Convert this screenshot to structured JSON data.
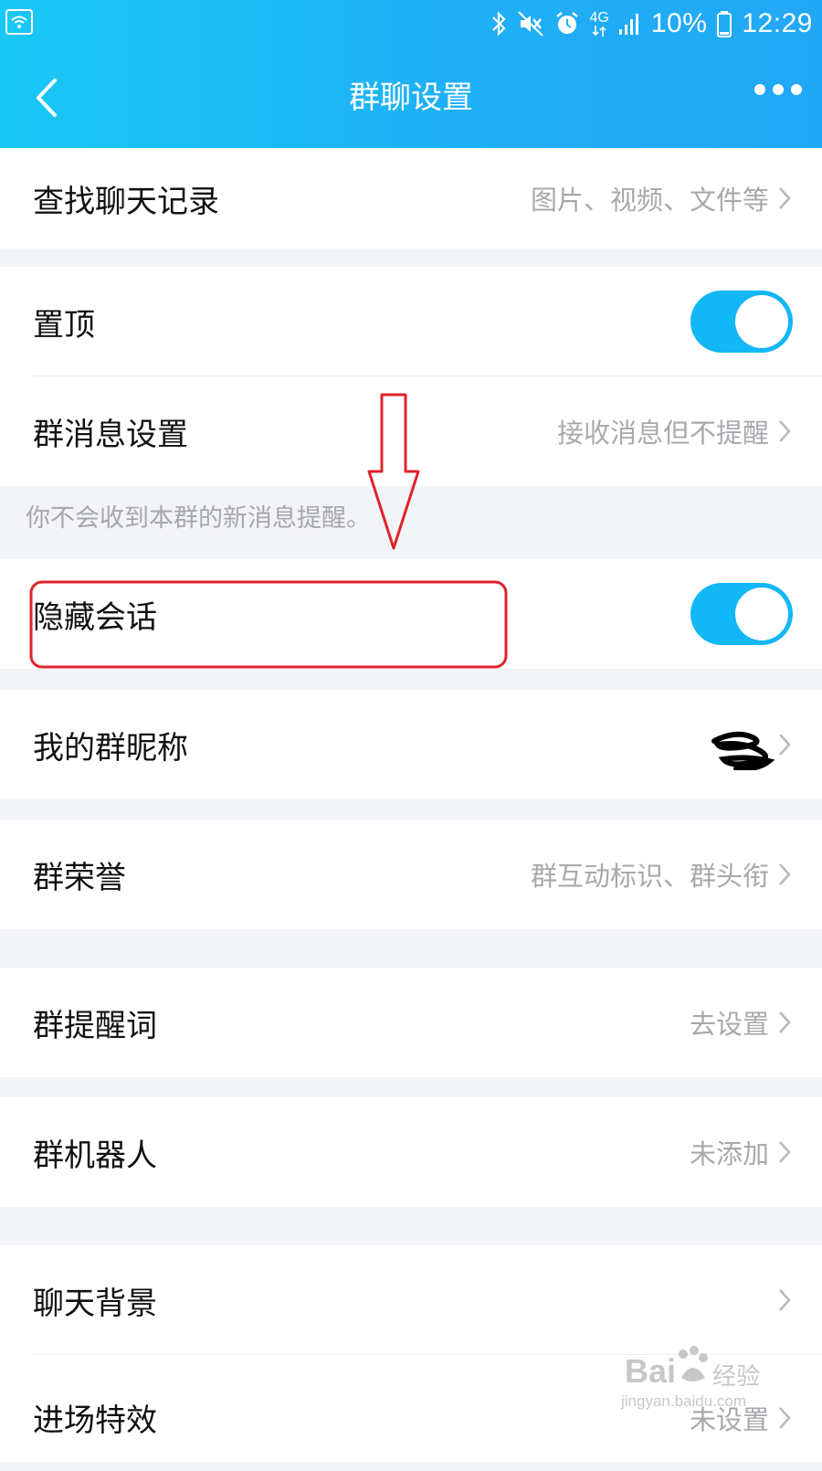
{
  "status_bar": {
    "battery": "10%",
    "time": "12:29",
    "network": "4G",
    "icons": [
      "wifi-icon",
      "bluetooth-icon",
      "mute-icon",
      "alarm-icon",
      "network-4g-icon",
      "signal-icon",
      "battery-icon"
    ]
  },
  "header": {
    "title": "群聊设置",
    "back_icon": "chevron-left-icon",
    "more_icon": "more-dots-icon"
  },
  "rows": {
    "search_history": {
      "label": "查找聊天记录",
      "value": "图片、视频、文件等"
    },
    "pin_top": {
      "label": "置顶",
      "toggle": true
    },
    "message_settings": {
      "label": "群消息设置",
      "value": "接收消息但不提醒"
    },
    "hint": "你不会收到本群的新消息提醒。",
    "hide_chat": {
      "label": "隐藏会话",
      "toggle": true
    },
    "nickname": {
      "label": "我的群昵称",
      "value": ""
    },
    "honor": {
      "label": "群荣誉",
      "value": "群互动标识、群头衔"
    },
    "reminder_words": {
      "label": "群提醒词",
      "value": "去设置"
    },
    "robot": {
      "label": "群机器人",
      "value": "未添加"
    },
    "background": {
      "label": "聊天背景",
      "value": ""
    },
    "entrance_effect": {
      "label": "进场特效",
      "value": "未设置"
    }
  },
  "watermark": {
    "brand": "Bai",
    "cn": "经验",
    "url": "jingyan.baidu.com"
  },
  "colors": {
    "header_start": "#19c8f5",
    "header_end": "#22a7f4",
    "toggle_on": "#12b7f5",
    "annotation_red": "#e0232b"
  }
}
